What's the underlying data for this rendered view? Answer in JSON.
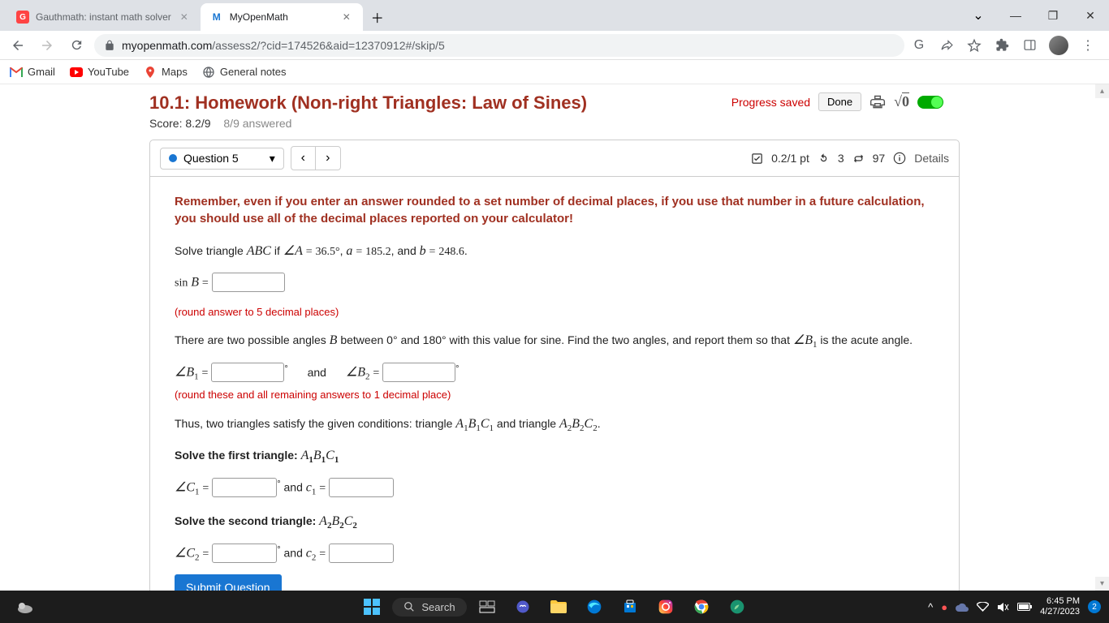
{
  "browser": {
    "tabs": [
      {
        "title": "Gauthmath: instant math solver",
        "active": false
      },
      {
        "title": "MyOpenMath",
        "active": true
      }
    ],
    "url_prefix": "myopenmath.com",
    "url_path": "/assess2/?cid=174526&aid=12370912#/skip/5",
    "bookmarks": [
      "Gmail",
      "YouTube",
      "Maps",
      "General notes"
    ]
  },
  "page": {
    "title": "10.1: Homework (Non-right Triangles: Law of Sines)",
    "score_label": "Score: 8.2/9",
    "answered_label": "8/9 answered",
    "progress_saved": "Progress saved",
    "done_label": "Done",
    "question_label": "Question 5",
    "points": "0.2/1 pt",
    "retry_1": "3",
    "retry_2": "97",
    "details_label": "Details",
    "instruction": "Remember, even if you enter an answer rounded to a set number of decimal places, if you use that number in a future calculation, you should use all of the decimal places reported on your calculator!",
    "problem_prefix": "Solve triangle ",
    "problem_abc": "ABC",
    "problem_mid1": " if ",
    "angle_A_val": "36.5",
    "a_val": "185.2",
    "b_val": "248.6",
    "sinB_label": "sin",
    "round5": "(round answer to 5 decimal places)",
    "two_angles_text": "There are two possible angles ",
    "two_angles_text2": " between 0° and 180° with this value for sine. Find the two angles, and report them so that ",
    "two_angles_text3": " is the acute angle.",
    "and_word": "and",
    "round1": "(round these and all remaining answers to 1 decimal place)",
    "thus_text": "Thus, two triangles satisfy the given conditions: triangle ",
    "thus_text2": " and triangle ",
    "solve_first": "Solve the first triangle: ",
    "solve_second": "Solve the second triangle: ",
    "and_c1": " and ",
    "submit_label": "Submit Question"
  },
  "taskbar": {
    "search_placeholder": "Search",
    "time": "6:45 PM",
    "date": "4/27/2023",
    "notif_count": "2"
  }
}
